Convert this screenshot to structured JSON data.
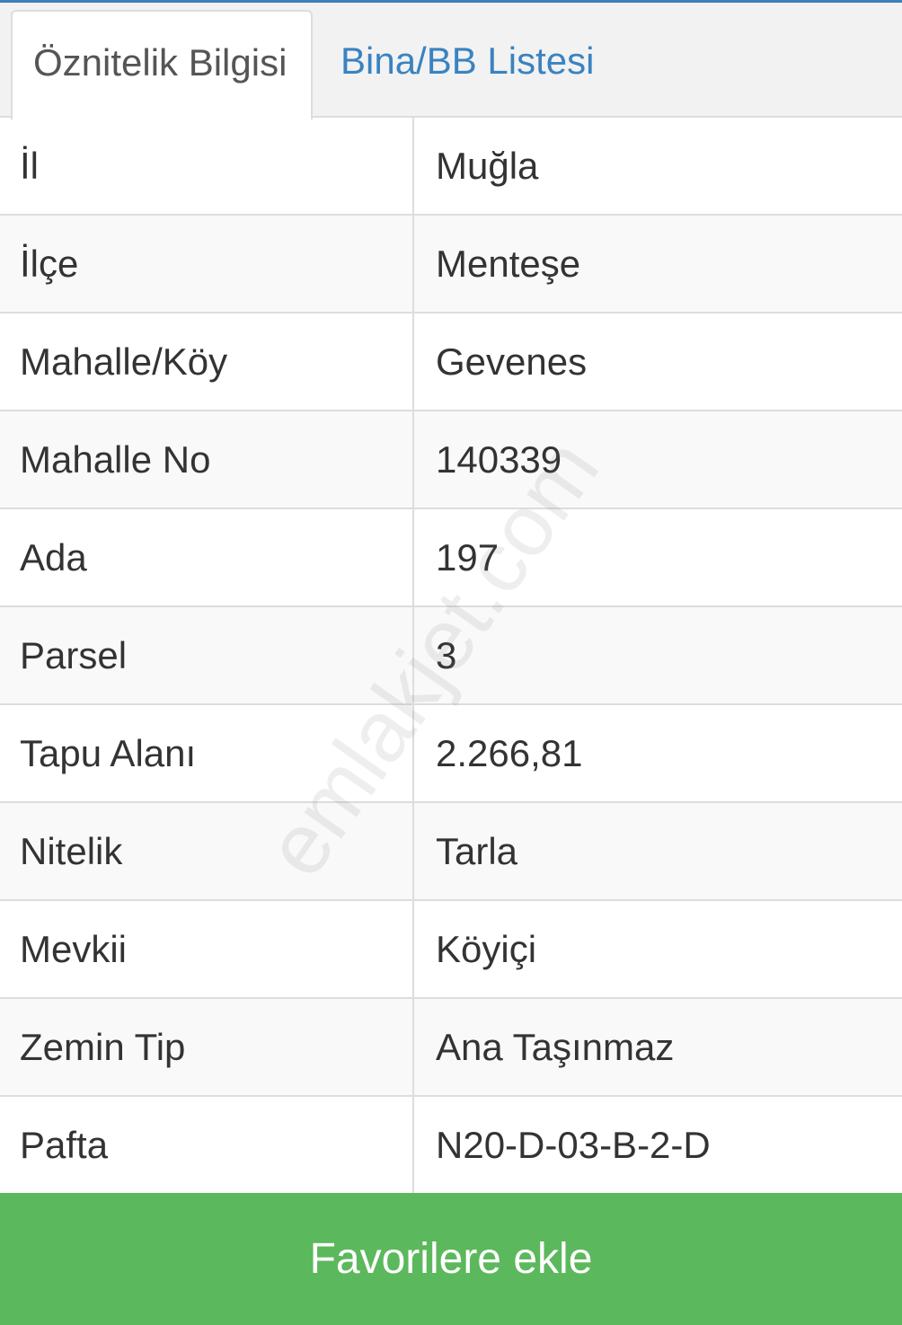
{
  "tabs": [
    {
      "label": "Öznitelik Bilgisi",
      "active": true
    },
    {
      "label": "Bina/BB Listesi",
      "active": false
    }
  ],
  "rows": [
    {
      "key": "İl",
      "value": "Muğla"
    },
    {
      "key": "İlçe",
      "value": "Menteşe"
    },
    {
      "key": "Mahalle/Köy",
      "value": "Gevenes"
    },
    {
      "key": "Mahalle No",
      "value": "140339"
    },
    {
      "key": "Ada",
      "value": "197"
    },
    {
      "key": "Parsel",
      "value": "3"
    },
    {
      "key": "Tapu Alanı",
      "value": "2.266,81"
    },
    {
      "key": "Nitelik",
      "value": "Tarla"
    },
    {
      "key": "Mevkii",
      "value": "Köyiçi"
    },
    {
      "key": "Zemin Tip",
      "value": "Ana Taşınmaz"
    },
    {
      "key": "Pafta",
      "value": "N20-D-03-B-2-D"
    }
  ],
  "watermark": "emlakjet.com",
  "favorite_button_label": "Favorilere ekle",
  "colors": {
    "accent": "#3a83c1",
    "button": "#5cb85c",
    "border": "#dddddd",
    "row_alt": "#f9f9f9"
  }
}
